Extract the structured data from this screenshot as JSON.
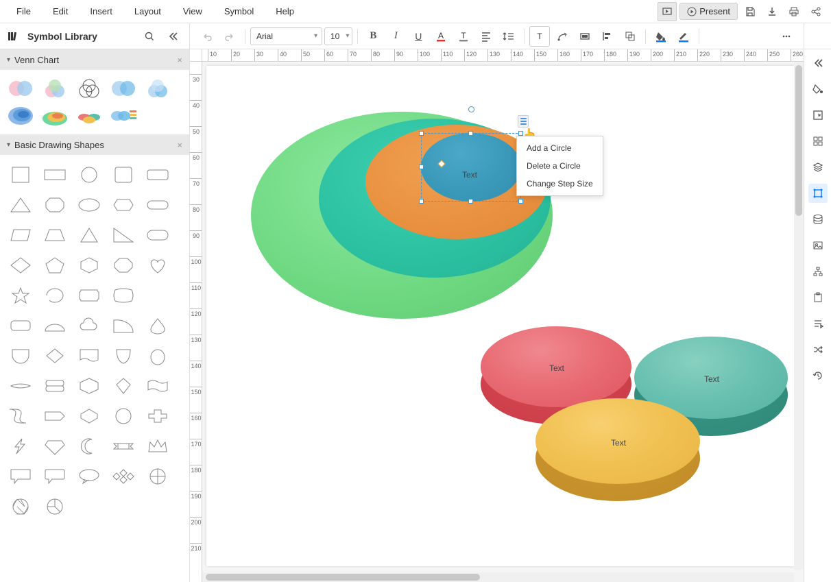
{
  "menu": {
    "items": [
      "File",
      "Edit",
      "Insert",
      "Layout",
      "View",
      "Symbol",
      "Help"
    ],
    "present": "Present"
  },
  "sidebar": {
    "title": "Symbol Library",
    "panels": {
      "venn": "Venn Chart",
      "shapes": "Basic Drawing Shapes"
    }
  },
  "toolbar": {
    "font": "Arial",
    "fontSize": "10"
  },
  "ruler": {
    "h": [
      "10",
      "20",
      "30",
      "40",
      "50",
      "60",
      "70",
      "80",
      "90",
      "100",
      "110",
      "120",
      "130",
      "140",
      "150",
      "160",
      "170",
      "180",
      "190",
      "200",
      "210",
      "220",
      "230",
      "240",
      "250",
      "260"
    ],
    "v": [
      "30",
      "40",
      "50",
      "60",
      "70",
      "80",
      "90",
      "100",
      "110",
      "120",
      "130",
      "140",
      "150",
      "160",
      "170",
      "180",
      "190",
      "200",
      "210"
    ]
  },
  "canvas": {
    "text_label": "Text",
    "disc_red": "Text",
    "disc_teal": "Text",
    "disc_yellow": "Text"
  },
  "context_menu": {
    "items": [
      "Add a Circle",
      "Delete a Circle",
      "Change Step Size"
    ]
  }
}
